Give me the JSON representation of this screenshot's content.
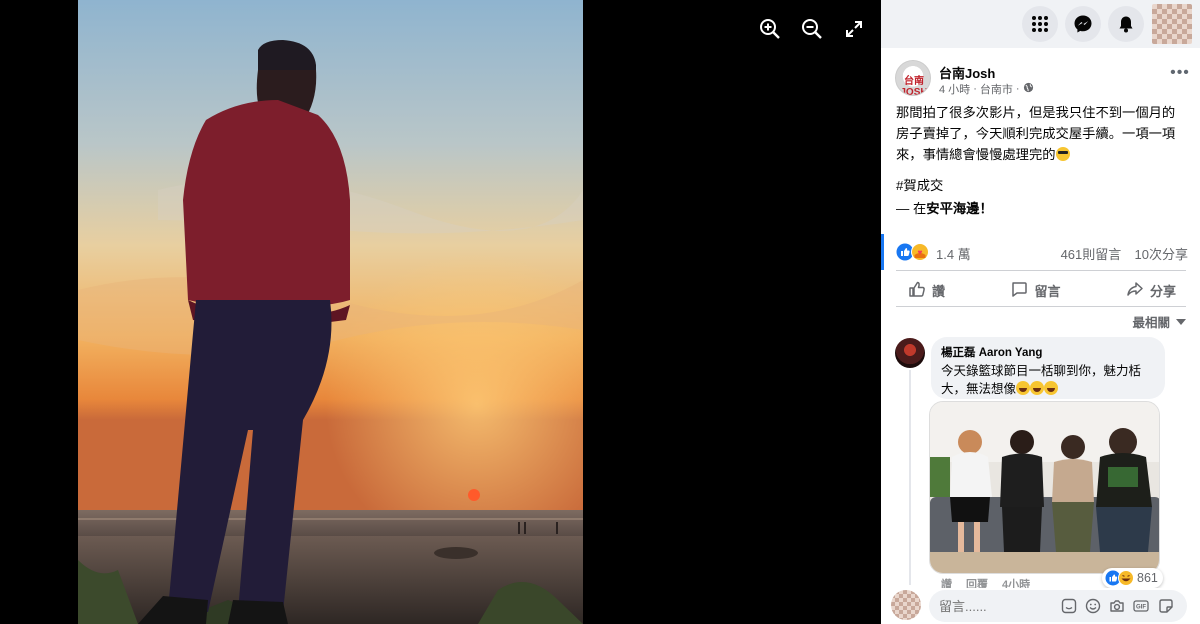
{
  "viewer": {
    "controls": [
      "zoom-in-icon",
      "zoom-out-icon",
      "fullscreen-icon"
    ]
  },
  "topbar": {
    "icons": [
      "menu-grid-icon",
      "messenger-icon",
      "notifications-bell-icon"
    ],
    "button_color": "#e4e6eb"
  },
  "post": {
    "author": "台南Josh",
    "avatar_logo_text": "台南 JOSH",
    "time": "4 小時",
    "location": "台南市",
    "audience_icon": "public-globe-icon",
    "body_lines": [
      "那間拍了很多次影片，但是我只住不到一個月的",
      "房子賣掉了，今天順利完成交屋手續。一項一項",
      "來，事情總會慢慢處理完的"
    ],
    "hashtag": "#賀成交",
    "checkin_prefix": "— 在",
    "checkin_place": "安平海邊",
    "checkin_suffix": "！",
    "reactions": [
      "like",
      "care"
    ],
    "reaction_count": "1.4 萬",
    "comments_count": "461則留言",
    "shares_count": "10次分享"
  },
  "actions": {
    "like": "讚",
    "comment": "留言",
    "share": "分享"
  },
  "sort": {
    "label": "最相關"
  },
  "comment": {
    "author": "楊正磊 Aaron Yang",
    "text_line1": "今天錄籃球節目一栝聊到你，魅力栝",
    "text_line2": "大，無法想像",
    "photo_desc_people": 4,
    "actions_visible": [
      "讚",
      "回覆",
      "4小時"
    ],
    "reaction_types": [
      "like",
      "haha"
    ],
    "reaction_count": "861"
  },
  "composer": {
    "placeholder": "留言......",
    "icons": [
      "sticker-icon",
      "emoji-icon",
      "camera-icon",
      "gif-icon",
      "sticker-alt-icon"
    ]
  },
  "colors": {
    "accent": "#1877f2",
    "secondary_text": "#65676b",
    "panel_bg": "#f0f2f5"
  }
}
